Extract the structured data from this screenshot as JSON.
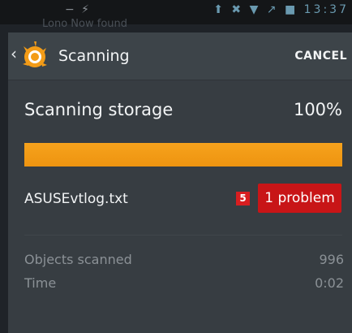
{
  "status_bar": {
    "left_text": "− ⚡",
    "right_text": "⬆ ✖ ▼ ↗ ■ 13:37",
    "notification_ghost": "Lono Now found"
  },
  "action_bar": {
    "title": "Scanning",
    "cancel_label": "CANCEL",
    "back_icon": "chevron-left-icon",
    "logo_icon": "avast-logo-icon"
  },
  "scan": {
    "label": "Scanning storage",
    "percent": "100%",
    "progress_fraction": 1.0
  },
  "result": {
    "file_name": "ASUSEvtlog.txt",
    "marker_number": "5",
    "problem_label": "1 problem"
  },
  "stats": {
    "objects_label": "Objects scanned",
    "objects_value": "996",
    "time_label": "Time",
    "time_value": "0:02"
  },
  "colors": {
    "accent_orange": "#f39c18",
    "problem_red": "#c81517",
    "background": "#373d42"
  }
}
